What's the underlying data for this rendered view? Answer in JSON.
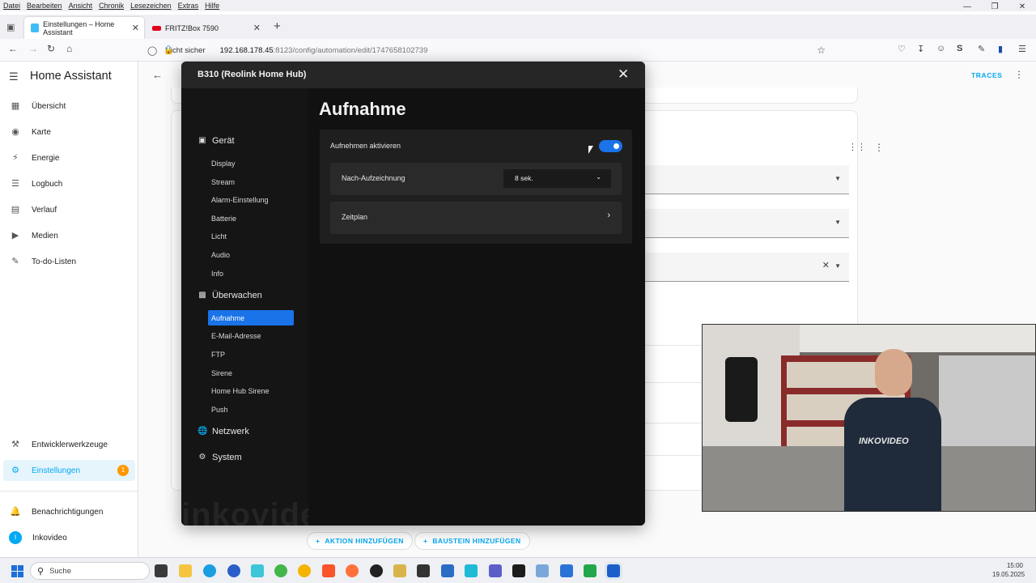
{
  "browser": {
    "menu": [
      "Datei",
      "Bearbeiten",
      "Ansicht",
      "Chronik",
      "Lesezeichen",
      "Extras",
      "Hilfe"
    ],
    "tabs": [
      {
        "label": "Einstellungen – Home Assistant",
        "active": true
      },
      {
        "label": "FRITZ!Box 7590",
        "active": false
      }
    ],
    "new_tab": "+",
    "url": {
      "security": "Nicht sicher",
      "host": "192.168.178.45",
      "path": ":8123/config/automation/edit/1747658102739"
    }
  },
  "ha": {
    "title": "Home Assistant",
    "sidebar": [
      {
        "label": "Übersicht",
        "icon": "dashboard-icon"
      },
      {
        "label": "Karte",
        "icon": "map-icon"
      },
      {
        "label": "Energie",
        "icon": "lightning-icon"
      },
      {
        "label": "Logbuch",
        "icon": "list-icon"
      },
      {
        "label": "Verlauf",
        "icon": "chart-icon"
      },
      {
        "label": "Medien",
        "icon": "media-icon"
      },
      {
        "label": "To-do-Listen",
        "icon": "clipboard-icon"
      }
    ],
    "sidebar_bottom": [
      {
        "label": "Entwicklerwerkzeuge",
        "icon": "hammer-icon"
      },
      {
        "label": "Einstellungen",
        "icon": "gear-icon",
        "badge": "1",
        "active": true
      },
      {
        "label": "Benachrichtigungen",
        "icon": "bell-icon"
      },
      {
        "label": "Inkovideo",
        "icon": "avatar-icon",
        "avatar_letter": "I"
      }
    ],
    "header_action": "TRACES",
    "buttons": {
      "add_action": "AKTION HINZUFÜGEN",
      "add_block": "BAUSTEIN HINZUFÜGEN"
    },
    "accent": "#03a9f4"
  },
  "dialog": {
    "title": "B310  (Reolink Home Hub)",
    "nav": {
      "groups": [
        {
          "label": "Gerät",
          "icon": "camera-icon",
          "items": [
            "Display",
            "Stream",
            "Alarm-Einstellung",
            "Batterie",
            "Licht",
            "Audio",
            "Info"
          ]
        },
        {
          "label": "Überwachen",
          "icon": "monitor-icon",
          "items": [
            "Aufnahme",
            "E-Mail-Adresse",
            "FTP",
            "Sirene",
            "Home Hub Sirene",
            "Push"
          ]
        },
        {
          "label": "Netzwerk",
          "icon": "globe-icon",
          "items": []
        },
        {
          "label": "System",
          "icon": "gear-icon",
          "items": []
        }
      ],
      "active_item": "Aufnahme"
    },
    "watermark": "inkovideo.de",
    "page_title": "Aufnahme",
    "record_enable_label": "Aufnehmen aktivieren",
    "record_enabled": true,
    "post_record_label": "Nach-Aufzeichnung",
    "post_record_value": "8 sek.",
    "schedule_label": "Zeitplan",
    "accent": "#1a73e8"
  },
  "webcam": {
    "shirt_text": "INKOVIDEO"
  },
  "taskbar": {
    "search_placeholder": "Suche",
    "time": "15:00",
    "date": "19.05.2025"
  }
}
